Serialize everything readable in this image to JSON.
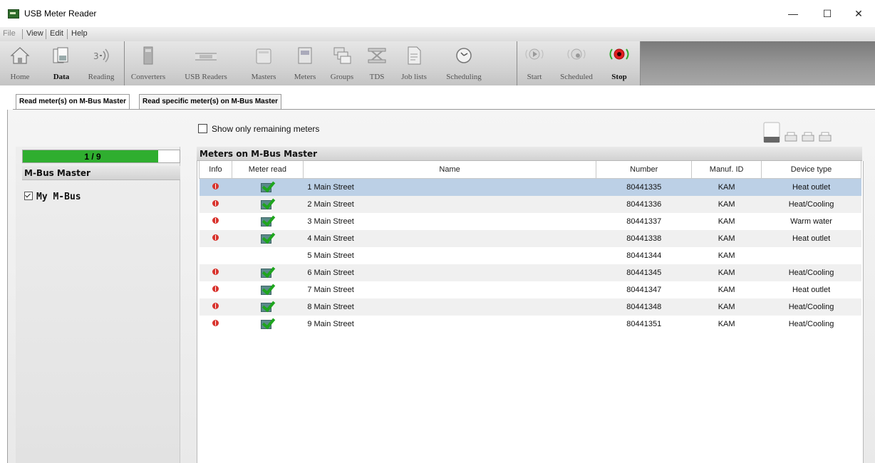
{
  "window": {
    "title": "USB Meter Reader",
    "controls": [
      "—",
      "☐",
      "✕"
    ]
  },
  "menu": [
    "File",
    "View",
    "Edit",
    "Help"
  ],
  "toolbar": {
    "nav": [
      "Home",
      "Data",
      "Reading"
    ],
    "config": [
      "Converters",
      "USB Readers",
      "Masters",
      "Meters",
      "Groups",
      "TDS",
      "Job lists",
      "Scheduling"
    ],
    "run": [
      "Start",
      "Scheduled",
      "Stop"
    ]
  },
  "tabs": [
    "Read meter(s) on M-Bus Master",
    "Read specific meter(s) on M-Bus Master"
  ],
  "options": {
    "show_remaining_label": "Show only remaining meters",
    "show_remaining_checked": false
  },
  "progress": {
    "text": "1 / 9",
    "fraction": 0.865,
    "color": "#2fae2f"
  },
  "left_panel": {
    "header": "M-Bus Master",
    "items": [
      {
        "label": "My M-Bus",
        "checked": true
      }
    ]
  },
  "meters": {
    "header": "Meters on M-Bus Master",
    "columns": [
      "Info",
      "Meter read",
      "Name",
      "Number",
      "Manuf. ID",
      "Device type"
    ],
    "rows": [
      {
        "info": true,
        "read": true,
        "name": "1 Main Street",
        "number": "80441335",
        "manuf": "KAM",
        "type": "Heat outlet",
        "selected": true
      },
      {
        "info": true,
        "read": true,
        "name": "2 Main Street",
        "number": "80441336",
        "manuf": "KAM",
        "type": "Heat/Cooling"
      },
      {
        "info": true,
        "read": true,
        "name": "3 Main Street",
        "number": "80441337",
        "manuf": "KAM",
        "type": "Warm water"
      },
      {
        "info": true,
        "read": true,
        "name": "4 Main Street",
        "number": "80441338",
        "manuf": "KAM",
        "type": "Heat outlet"
      },
      {
        "info": false,
        "read": false,
        "name": "5 Main Street",
        "number": "80441344",
        "manuf": "KAM",
        "type": ""
      },
      {
        "info": true,
        "read": true,
        "name": "6 Main Street",
        "number": "80441345",
        "manuf": "KAM",
        "type": "Heat/Cooling"
      },
      {
        "info": true,
        "read": true,
        "name": "7 Main Street",
        "number": "80441347",
        "manuf": "KAM",
        "type": "Heat outlet"
      },
      {
        "info": true,
        "read": true,
        "name": "8 Main Street",
        "number": "80441348",
        "manuf": "KAM",
        "type": "Heat/Cooling"
      },
      {
        "info": true,
        "read": true,
        "name": "9 Main Street",
        "number": "80441351",
        "manuf": "KAM",
        "type": "Heat/Cooling"
      }
    ]
  },
  "colors": {
    "selection": "#bcd0e6",
    "progress": "#2fae2f",
    "stop": "#e02020"
  },
  "icons": {
    "app": "usb-meter-app-icon",
    "home": "house-icon",
    "data": "documents-icon",
    "reading": "signal-reading-icon",
    "info": "red-info-icon",
    "meter_read": "meter-read-check-icon",
    "printer": "printer-icon"
  }
}
